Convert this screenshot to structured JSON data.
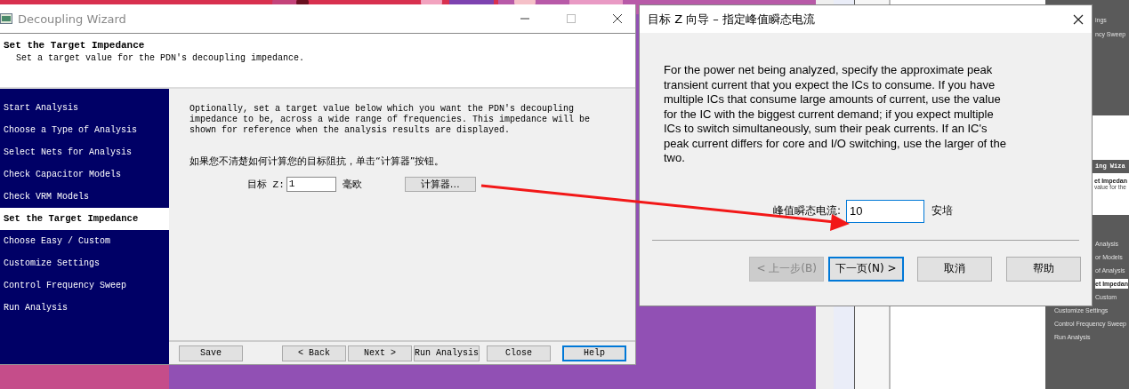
{
  "background_window": {
    "top_items": [
      "ings",
      "ncy Sweep"
    ],
    "banner": "ing Wiza",
    "heading": "et Impedan",
    "subheading": "value for the",
    "steps": [
      {
        "label": "Analysis",
        "kind": "clipped",
        "selected": false
      },
      {
        "label": "or Models",
        "kind": "clipped",
        "selected": false
      },
      {
        "label": "of Analysis",
        "kind": "clipped",
        "selected": false
      },
      {
        "label": "et Impedan",
        "kind": "clipped",
        "selected": true
      },
      {
        "label": "Custom",
        "kind": "clipped",
        "selected": false
      },
      {
        "label": "Customize Settings",
        "kind": "full",
        "selected": false
      },
      {
        "label": "Control Frequency Sweep",
        "kind": "full",
        "selected": false
      },
      {
        "label": "Run Analysis",
        "kind": "full",
        "selected": false
      }
    ]
  },
  "main_window": {
    "title": "Decoupling Wizard",
    "header": {
      "title": "Set the Target Impedance",
      "subtitle": "Set a target value for the PDN's decoupling impedance."
    },
    "steps": [
      {
        "label": "Start Analysis",
        "selected": false
      },
      {
        "label": "Choose a Type of Analysis",
        "selected": false
      },
      {
        "label": "Select Nets for Analysis",
        "selected": false
      },
      {
        "label": "Check Capacitor Models",
        "selected": false
      },
      {
        "label": "Check VRM Models",
        "selected": false
      },
      {
        "label": "Set the Target Impedance",
        "selected": true
      },
      {
        "label": "Choose Easy / Custom",
        "selected": false
      },
      {
        "label": "Customize Settings",
        "selected": false
      },
      {
        "label": "Control Frequency Sweep",
        "selected": false
      },
      {
        "label": "Run Analysis",
        "selected": false
      }
    ],
    "description": "Optionally, set a target value below which you want the PDN's decoupling impedance to be, across a wide range of frequencies. This impedance will be shown for reference when the analysis results are displayed.",
    "hint": "如果您不清楚如何计算您的目标阻抗，单击“计算器”按钮。",
    "target_z": {
      "label": "目标 Z:",
      "value": "1",
      "unit": "毫欧"
    },
    "calculator_button": "计算器…",
    "buttons": [
      {
        "label": "Save",
        "focused": false
      },
      {
        "label": "< Back",
        "focused": false
      },
      {
        "label": "Next >",
        "focused": false
      },
      {
        "label": "Run Analysis",
        "focused": false
      },
      {
        "label": "Close",
        "focused": false
      },
      {
        "label": "Help",
        "focused": true
      }
    ]
  },
  "dialog": {
    "title": "目标 Z 向导 – 指定峰值瞬态电流",
    "description": "For the power net being analyzed, specify the approximate peak transient current that you expect the ICs to consume. If you have multiple ICs that consume large amounts of current, use the value for the IC with the biggest current demand; if you expect multiple ICs to switch simultaneously, sum their peak currents. If an IC's peak current differs for core and I/O switching, use the larger of the two.",
    "field": {
      "label": "峰值瞬态电流:",
      "value": "10",
      "unit": "安培"
    },
    "buttons": [
      {
        "label": "< 上一步(B)",
        "disabled": true,
        "focused": false
      },
      {
        "label": "下一页(N) >",
        "disabled": false,
        "focused": true
      },
      {
        "label": "取消",
        "disabled": false,
        "focused": false
      },
      {
        "label": "帮助",
        "disabled": false,
        "focused": false
      }
    ]
  }
}
